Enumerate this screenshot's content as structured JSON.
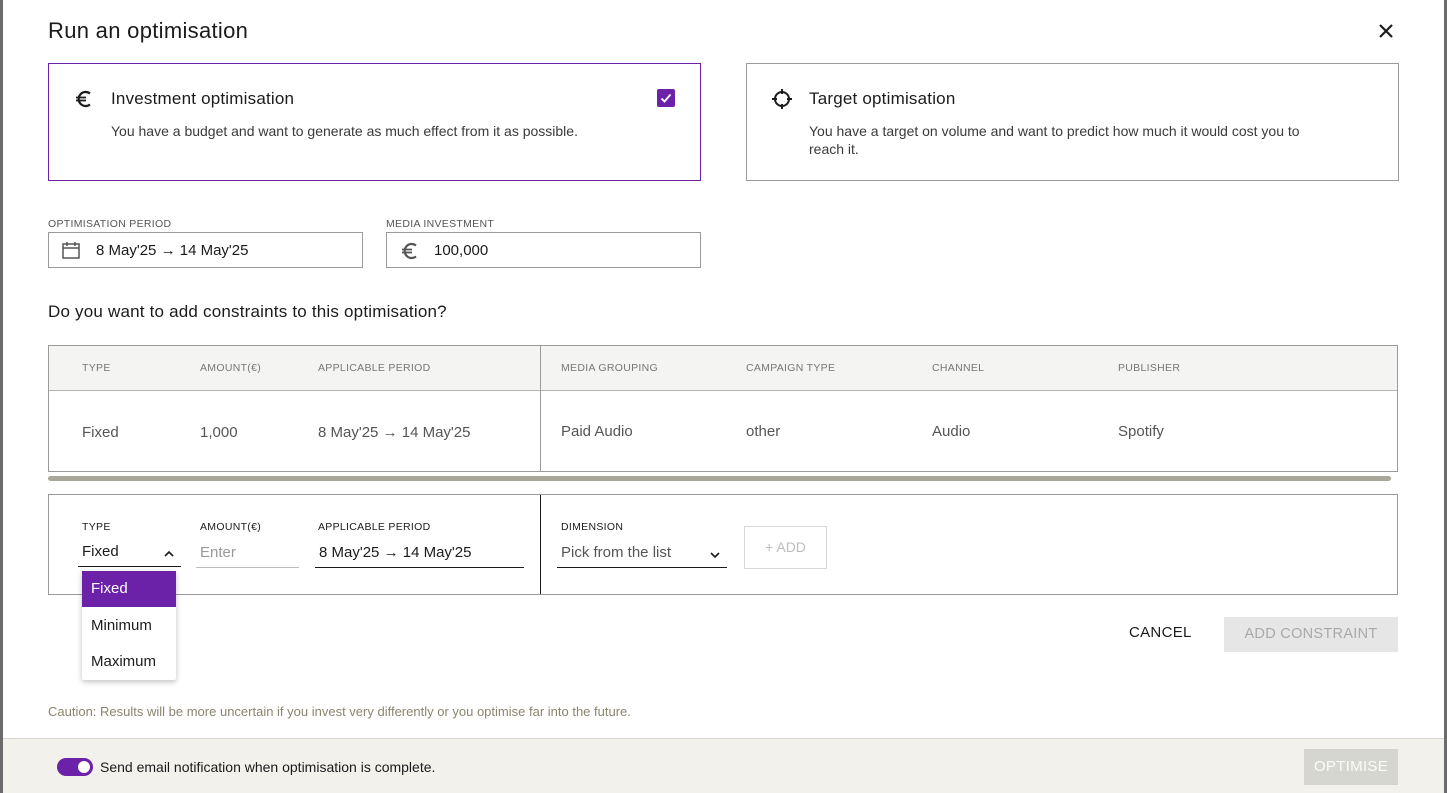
{
  "dialog": {
    "title": "Run an optimisation",
    "close_icon": "close-icon"
  },
  "options": {
    "investment": {
      "icon": "euro-icon",
      "title": "Investment optimisation",
      "description": "You have a budget and want to generate as much effect from it as possible.",
      "selected": true
    },
    "target": {
      "icon": "crosshair-icon",
      "title": "Target optimisation",
      "description": "You have a target on volume and want to predict how much it would cost you to reach it.",
      "selected": false
    }
  },
  "fields": {
    "period_label": "OPTIMISATION PERIOD",
    "period_value": "8 May'25 → 14 May'25",
    "investment_label": "MEDIA INVESTMENT",
    "investment_value": "100,000"
  },
  "constraints_question": "Do you want to add constraints to this optimisation?",
  "table": {
    "headers": {
      "type": "TYPE",
      "amount": "AMOUNT(€)",
      "period": "APPLICABLE PERIOD",
      "grouping": "MEDIA GROUPING",
      "campaign": "CAMPAIGN TYPE",
      "channel": "CHANNEL",
      "publisher": "PUBLISHER"
    },
    "rows": [
      {
        "type": "Fixed",
        "amount": "1,000",
        "period": "8 May'25 → 14 May'25",
        "grouping": "Paid Audio",
        "campaign": "other",
        "channel": "Audio",
        "publisher": "Spotify"
      }
    ]
  },
  "editor": {
    "type_label": "TYPE",
    "type_value": "Fixed",
    "amount_label": "AMOUNT(€)",
    "amount_placeholder": "Enter",
    "period_label": "APPLICABLE PERIOD",
    "period_value": "8 May'25 → 14 May'25",
    "dimension_label": "DIMENSION",
    "dimension_placeholder": "Pick from the list",
    "add_label": "+ ADD"
  },
  "type_dropdown": {
    "options": [
      "Fixed",
      "Minimum",
      "Maximum"
    ],
    "selected": "Fixed"
  },
  "actions": {
    "cancel": "CANCEL",
    "add_constraint": "ADD CONSTRAINT"
  },
  "caution": "Caution: Results will be more uncertain if you invest very differently or you optimise far into the future.",
  "footer": {
    "notify_label": "Send email notification when optimisation is complete.",
    "notify_enabled": true,
    "optimise": "OPTIMISE"
  },
  "colors": {
    "accent": "#6b21a8",
    "disabled": "#e6e6e6",
    "caution_text": "#8a8570"
  }
}
